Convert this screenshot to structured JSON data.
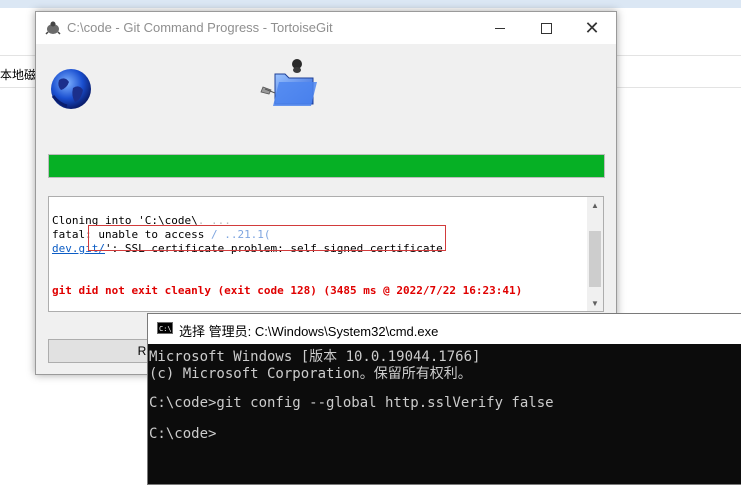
{
  "background": {
    "explorer_text": "本地磁盘"
  },
  "tortoise": {
    "title": "C:\\code - Git Command Progress - TortoiseGit",
    "minimize_icon": "minimize-icon",
    "maximize_icon": "maximize-icon",
    "close_glyph": "✕",
    "progress": 1.0,
    "progress_color": "#06b025",
    "log": {
      "line1": "Cloning into 'C:\\code\\",
      "line1_blurred": ".      ...",
      "line2_prefix": "fatal: unable to access",
      "line2_blurred": "        /        ..21.1(",
      "line3_link": "dev.git/",
      "line3_tail": "': SSL certificate problem: self signed certificate",
      "line4_error": "git did not exit cleanly (exit code 128) (3485 ms @ 2022/7/22 16:23:41)",
      "error_color": "#e00000"
    },
    "button_label": "R"
  },
  "cmd": {
    "title": "选择 管理员: C:\\Windows\\System32\\cmd.exe",
    "icon_text": "C:\\",
    "lines": [
      "Microsoft Windows [版本 10.0.19044.1766]",
      "(c) Microsoft Corporation。保留所有权利。",
      "",
      "C:\\code>git config --global http.sslVerify false",
      "",
      "C:\\code>"
    ]
  }
}
